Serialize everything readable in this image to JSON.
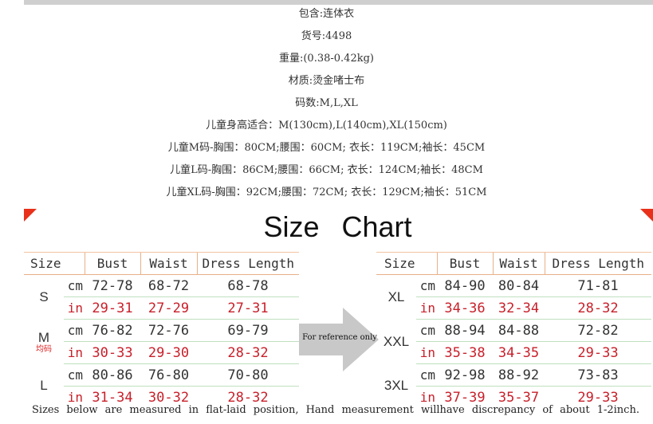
{
  "info_lines": [
    "包含:连体衣",
    "货号:4498",
    "重量:(0.38-0.42kg)",
    "材质:烫金啫士布",
    "码数:M,L,XL",
    "儿童身高适合：M(130cm),L(140cm),XL(150cm)",
    "儿童M码-胸围：80CM;腰围：60CM; 衣长：119CM;袖长：45CM",
    "儿童L码-胸围：86CM;腰围：66CM; 衣长：124CM;袖长：48CM",
    "儿童XL码-胸围：92CM;腰围：72CM; 衣长：129CM;袖长：51CM"
  ],
  "title": {
    "word1": "Size",
    "word2": "Chart"
  },
  "headers": {
    "size": "Size",
    "bust": "Bust",
    "waist": "Waist",
    "length": "Dress Length"
  },
  "units": {
    "cm": "cm",
    "in": "in"
  },
  "left_table": [
    {
      "size": "S",
      "note": "",
      "cm": [
        "72-78",
        "68-72",
        "68-78"
      ],
      "in": [
        "29-31",
        "27-29",
        "27-31"
      ]
    },
    {
      "size": "M",
      "note": "均码",
      "cm": [
        "76-82",
        "72-76",
        "69-79"
      ],
      "in": [
        "30-33",
        "29-30",
        "28-32"
      ]
    },
    {
      "size": "L",
      "note": "",
      "cm": [
        "80-86",
        "76-80",
        "70-80"
      ],
      "in": [
        "31-34",
        "30-32",
        "28-32"
      ]
    }
  ],
  "right_table": [
    {
      "size": "XL",
      "cm": [
        "84-90",
        "80-84",
        "71-81"
      ],
      "in": [
        "34-36",
        "32-34",
        "28-32"
      ]
    },
    {
      "size": "XXL",
      "cm": [
        "88-94",
        "84-88",
        "72-82"
      ],
      "in": [
        "35-38",
        "34-35",
        "29-33"
      ]
    },
    {
      "size": "3XL",
      "cm": [
        "92-98",
        "88-92",
        "73-83"
      ],
      "in": [
        "37-39",
        "35-37",
        "29-33"
      ]
    }
  ],
  "arrow_label": "For reference only",
  "footer_words": [
    "Sizes",
    "below",
    "are",
    "measured",
    "in",
    "flat-laid",
    "position,",
    "Hand",
    "measurement",
    "willhave",
    "discrepancy",
    "of",
    "about",
    "1-2inch."
  ]
}
